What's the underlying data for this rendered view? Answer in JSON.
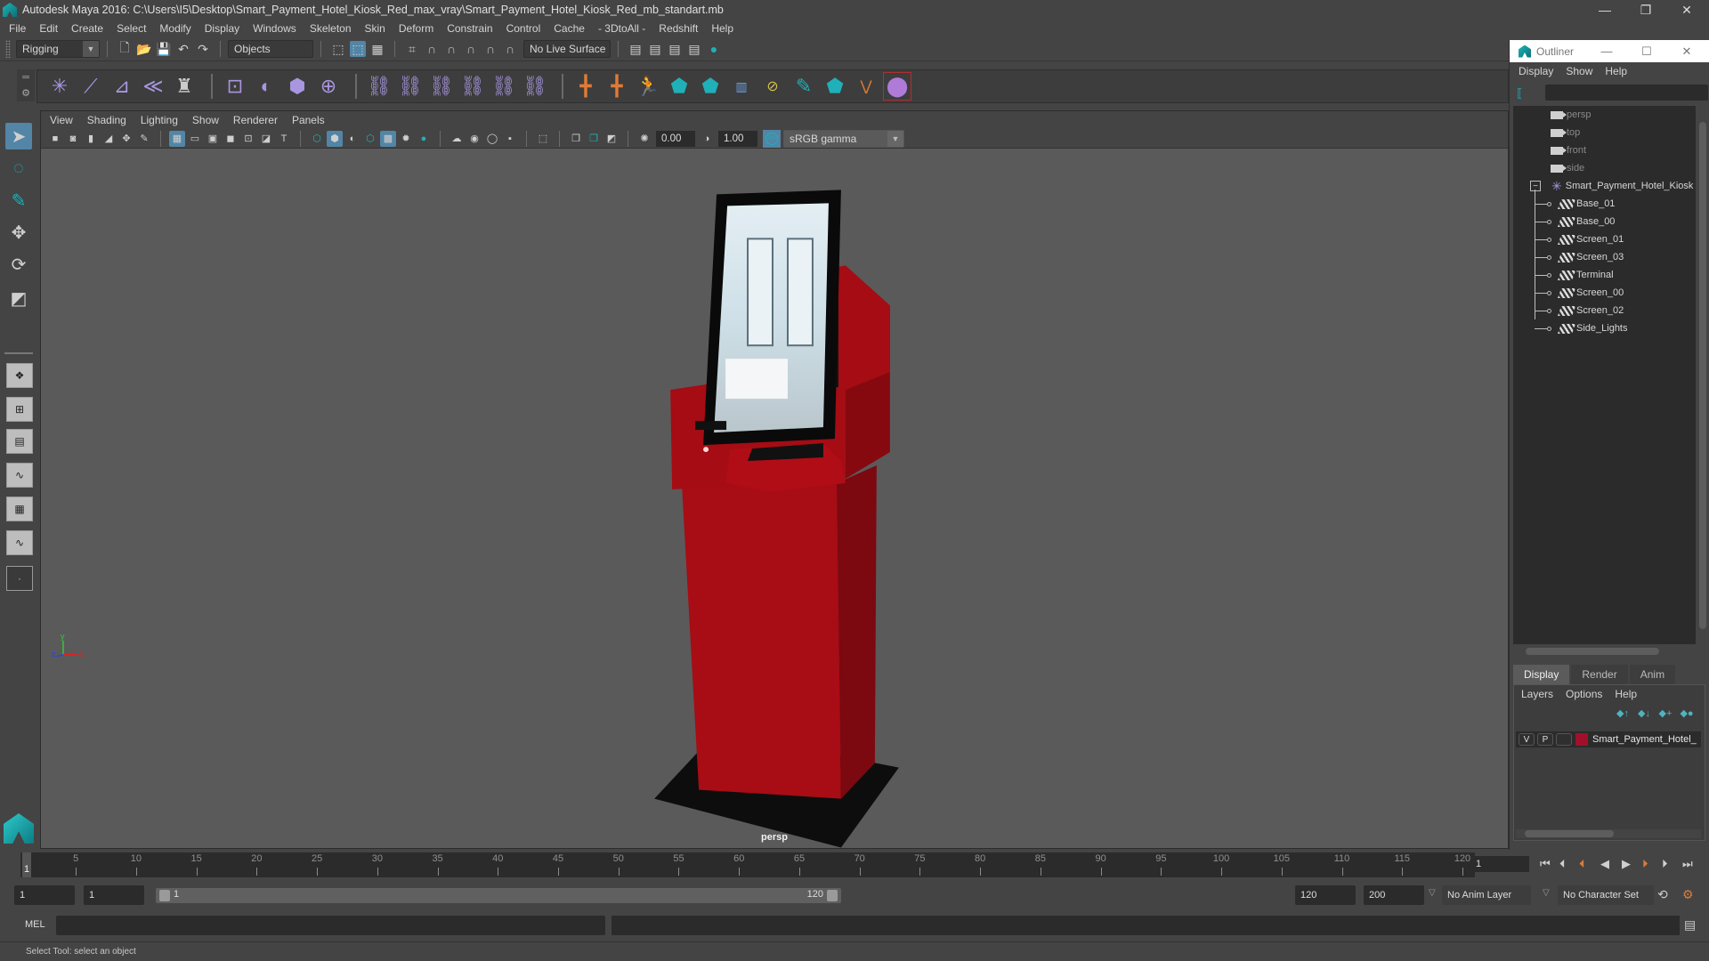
{
  "window": {
    "title": "Autodesk Maya 2016: C:\\Users\\I5\\Desktop\\Smart_Payment_Hotel_Kiosk_Red_max_vray\\Smart_Payment_Hotel_Kiosk_Red_mb_standart.mb",
    "minimize": "—",
    "restore": "❐",
    "close": "✕"
  },
  "menubar": [
    "File",
    "Edit",
    "Create",
    "Select",
    "Modify",
    "Display",
    "Windows",
    "Skeleton",
    "Skin",
    "Deform",
    "Constrain",
    "Control",
    "Cache",
    "- 3DtoAll -",
    "Redshift",
    "Help"
  ],
  "statusline": {
    "menuset": "Rigging",
    "selection_mode": "Objects",
    "live_surface": "No Live Surface"
  },
  "shelf": {
    "icons": [
      "joint-tool-icon",
      "ik-handle-icon",
      "ik-spline-icon",
      "insert-joint-icon",
      "humanik-icon",
      "bind-skin-icon",
      "smooth-bind-icon",
      "lattice-icon",
      "cluster-icon",
      "parent-constraint-icon",
      "point-constraint-icon",
      "orient-constraint-icon",
      "scale-constraint-icon",
      "aim-constraint-icon",
      "pole-vector-icon",
      "locator-icon",
      "ik-fk-icon",
      "character-icon",
      "maya-logo-icon",
      "maya-logo-icon-2",
      "set-driven-key-icon",
      "layer-icon",
      "paint-weights-icon",
      "maya-home-icon",
      "curve-icon",
      "primitives-icon"
    ]
  },
  "viewport": {
    "menu": [
      "View",
      "Shading",
      "Lighting",
      "Show",
      "Renderer",
      "Panels"
    ],
    "exposure": "0.00",
    "gamma": "1.00",
    "color_mgmt_on": "ON",
    "colorspace": "sRGB gamma",
    "camera": "persp",
    "axis": {
      "x": "x",
      "y": "y",
      "z": "z"
    },
    "model_colors": {
      "body": "#a80c14",
      "body_dark": "#7a0810",
      "screen_frame": "#0a0a0a",
      "base": "#111111"
    }
  },
  "outliner": {
    "title": "Outliner",
    "menu": [
      "Display",
      "Show",
      "Help"
    ],
    "search_value": "",
    "cameras": [
      "persp",
      "top",
      "front",
      "side"
    ],
    "group": "Smart_Payment_Hotel_Kiosk",
    "children": [
      "Base_01",
      "Base_00",
      "Screen_01",
      "Screen_03",
      "Terminal",
      "Screen_00",
      "Screen_02",
      "Side_Lights"
    ]
  },
  "layer_editor": {
    "tabs": [
      "Display",
      "Render",
      "Anim"
    ],
    "active_tab": "Display",
    "menu": [
      "Layers",
      "Options",
      "Help"
    ],
    "layers": [
      {
        "v": "V",
        "p": "P",
        "color": "#a0102a",
        "name": "Smart_Payment_Hotel_"
      }
    ]
  },
  "timeline": {
    "ticks": [
      5,
      10,
      15,
      20,
      25,
      30,
      35,
      40,
      45,
      50,
      55,
      60,
      65,
      70,
      75,
      80,
      85,
      90,
      95,
      100,
      105,
      110,
      115,
      120
    ],
    "min": 1,
    "max": 120,
    "current_frame": "1",
    "current_frame_field": "1"
  },
  "range": {
    "start_field": "1",
    "playback_start": "1",
    "range_start_label": "1",
    "range_end_label": "120",
    "playback_end": "120",
    "end_field": "200",
    "anim_layer": "No Anim Layer",
    "character_set": "No Character Set"
  },
  "command": {
    "label": "MEL",
    "value": "",
    "result": ""
  },
  "helpline": "Select Tool: select an object"
}
